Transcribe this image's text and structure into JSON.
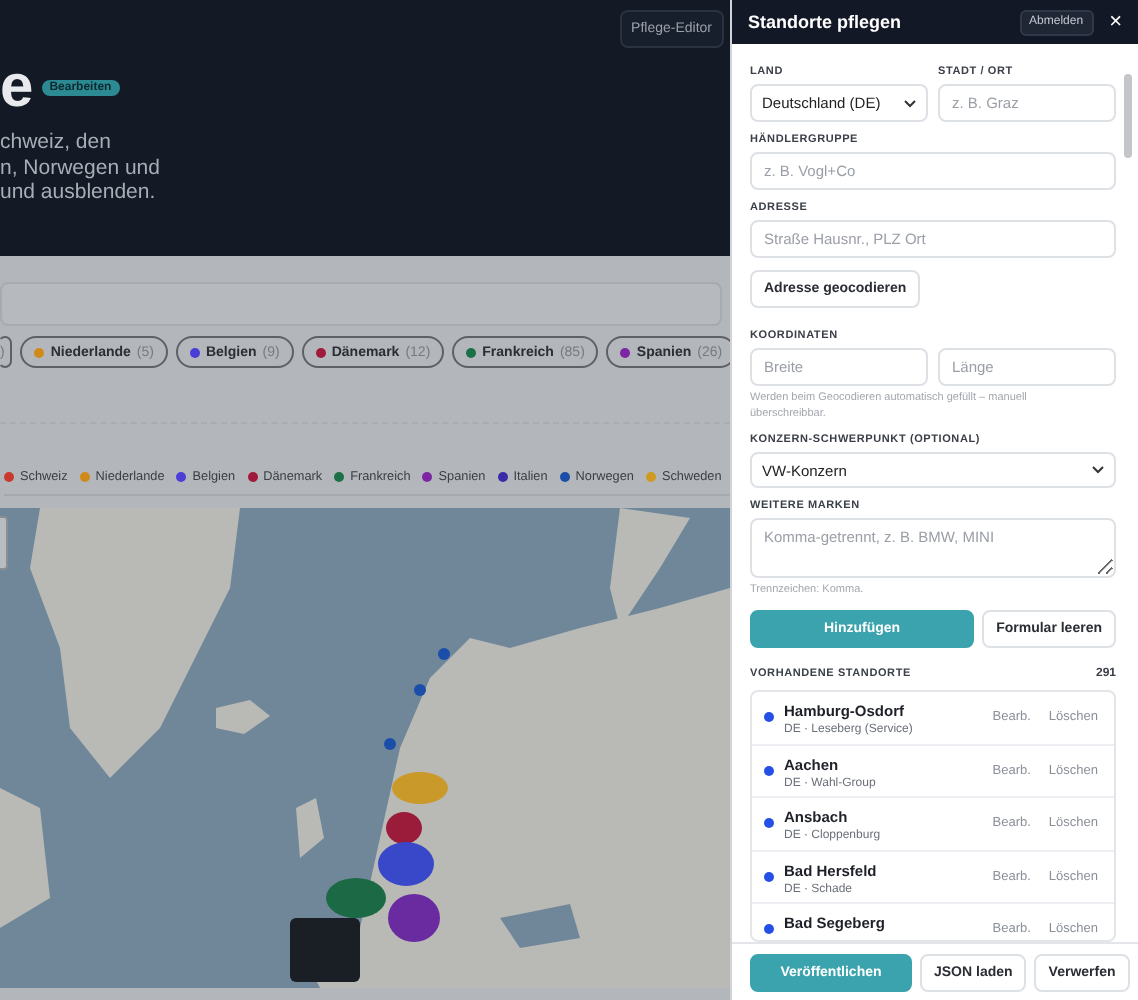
{
  "header": {
    "title": "e",
    "badge": "Bearbeiten",
    "description": [
      "chweiz, den",
      "n, Norwegen und",
      "und ausblenden."
    ],
    "editor_button": "Pflege-Editor"
  },
  "filter_chips": [
    {
      "count": ")"
    },
    {
      "name": "Niederlande",
      "count": "(5)",
      "color": "#d08a1a"
    },
    {
      "name": "Belgien",
      "count": "(9)",
      "color": "#4b3ed6"
    },
    {
      "name": "Dänemark",
      "count": "(12)",
      "color": "#a01a3c"
    },
    {
      "name": "Frankreich",
      "count": "(85)",
      "color": "#1c7048"
    },
    {
      "name": "Spanien",
      "count": "(26)",
      "color": "#7d25a3"
    }
  ],
  "legend": [
    {
      "name": "Schweiz",
      "color": "#c83a2e"
    },
    {
      "name": "Niederlande",
      "color": "#d08a1a"
    },
    {
      "name": "Belgien",
      "color": "#4b3ed6"
    },
    {
      "name": "Dänemark",
      "color": "#a01a3c"
    },
    {
      "name": "Frankreich",
      "color": "#1c7048"
    },
    {
      "name": "Spanien",
      "color": "#7d25a3"
    },
    {
      "name": "Italien",
      "color": "#3a2aa8"
    },
    {
      "name": "Norwegen",
      "color": "#1b4ea8"
    },
    {
      "name": "Schweden",
      "color": "#d09a22"
    }
  ],
  "drawer": {
    "title": "Standorte pflegen",
    "logout": "Abmelden",
    "close": "×",
    "land": {
      "label": "LAND",
      "value": "Deutschland (DE)"
    },
    "city": {
      "label": "STADT / ORT",
      "placeholder": "z. B. Graz"
    },
    "group": {
      "label": "HÄNDLERGRUPPE",
      "placeholder": "z. B. Vogl+Co"
    },
    "address": {
      "label": "ADRESSE",
      "placeholder": "Straße Hausnr., PLZ Ort"
    },
    "geocode_button": "Adresse geocodieren",
    "coords": {
      "label": "KOORDINATEN",
      "lat_placeholder": "Breite",
      "lng_placeholder": "Länge",
      "hint": "Werden beim Geocodieren automatisch gefüllt – manuell überschreibbar."
    },
    "focus": {
      "label": "KONZERN-SCHWERPUNKT (OPTIONAL)",
      "value": "VW-Konzern"
    },
    "brands": {
      "label": "WEITERE MARKEN",
      "placeholder": "Komma-getrennt, z. B. BMW, MINI",
      "hint": "Trennzeichen: Komma."
    },
    "add_button": "Hinzufügen",
    "clear_button": "Formular leeren",
    "list_title": "VORHANDENE STANDORTE",
    "list_count": "291",
    "locations": [
      {
        "name": "Hamburg-Osdorf",
        "meta": "DE · Leseberg (Service)",
        "color": "#2450e6",
        "edit": "Bearb.",
        "delete": "Löschen"
      },
      {
        "name": "Aachen",
        "meta": "DE · Wahl-Group",
        "color": "#2450e6",
        "edit": "Bearb.",
        "delete": "Löschen"
      },
      {
        "name": "Ansbach",
        "meta": "DE · Cloppenburg",
        "color": "#2450e6",
        "edit": "Bearb.",
        "delete": "Löschen"
      },
      {
        "name": "Bad Hersfeld",
        "meta": "DE · Schade",
        "color": "#2450e6",
        "edit": "Bearb.",
        "delete": "Löschen"
      },
      {
        "name": "Bad Segeberg",
        "color": "#2450e6",
        "edit": "Bearb.",
        "delete": "Löschen"
      }
    ],
    "footer": {
      "publish": "Veröffentlichen",
      "load": "JSON laden",
      "discard": "Verwerfen"
    }
  }
}
